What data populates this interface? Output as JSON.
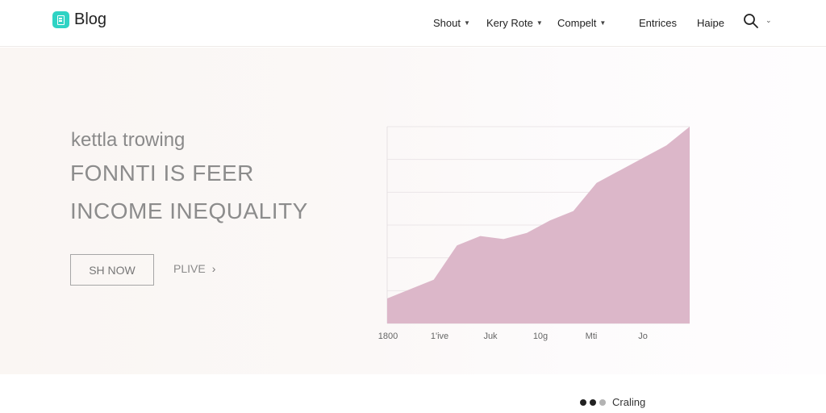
{
  "header": {
    "logo_text": "Blog",
    "nav": [
      {
        "label": "Shout",
        "has_caret": true
      },
      {
        "label": "Kery Rote",
        "has_caret": true
      },
      {
        "label": "Compelt",
        "has_caret": true
      },
      {
        "label": "Entrices",
        "has_caret": false
      },
      {
        "label": "Haipe",
        "has_caret": false
      }
    ],
    "search_icon": "search-icon",
    "accent_color": "#2fd3c4"
  },
  "hero": {
    "subtitle": "kettla trowing",
    "title_line_1": "FONNTI IS FEER",
    "title_line_2": "INCOME INEQUALITY",
    "primary_button": "SH NOW",
    "secondary_link": "PLIVE",
    "secondary_link_icon": "chevron-right-icon"
  },
  "chart_data": {
    "type": "area",
    "x_tick_labels": [
      "1800",
      "1'ive",
      "Juk",
      "10g",
      "Mti",
      "Jo"
    ],
    "series": [
      {
        "values": [
          8,
          11,
          14,
          25,
          28,
          27,
          29,
          33,
          36,
          45,
          49,
          53,
          57,
          63
        ]
      }
    ],
    "ylim": [
      0,
      63
    ],
    "grid": true,
    "fill_color": "#dcb7c9"
  },
  "footer": {
    "carousel_label": "Craling",
    "carousel_dots": 3,
    "active_dot_color": "#222222",
    "inactive_dot_color": "#b3b3b3"
  }
}
